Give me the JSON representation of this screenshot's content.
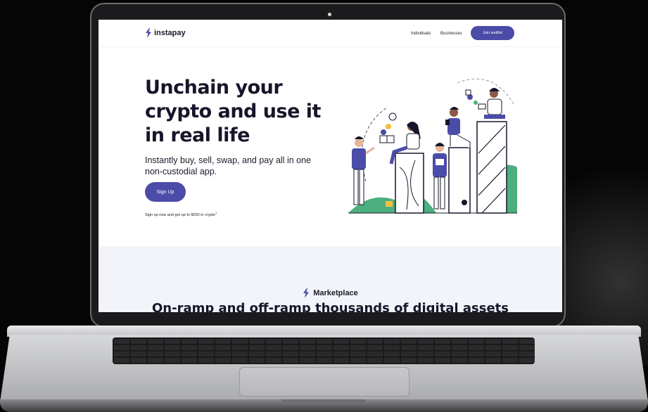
{
  "site": {
    "logo_text": "instapay",
    "nav": {
      "links": [
        "Individuals",
        "Businesses"
      ],
      "cta_label": "Join waitlist"
    },
    "hero": {
      "title_lines": [
        "Unchain your",
        "crypto and use it",
        "in real life"
      ],
      "subtitle": "Instantly buy, sell, swap, and pay all in one non-custodial app.",
      "signup_label": "Sign Up",
      "fineprint": "Sign up now and get up to $200 in crypto"
    },
    "marketplace": {
      "label": "Marketplace",
      "heading": "On-ramp and off-ramp thousands of digital assets"
    }
  },
  "colors": {
    "brand": "#4b4ba8",
    "text": "#16162a",
    "accent_green": "#4caf7d",
    "band": "#f2f4f9"
  }
}
